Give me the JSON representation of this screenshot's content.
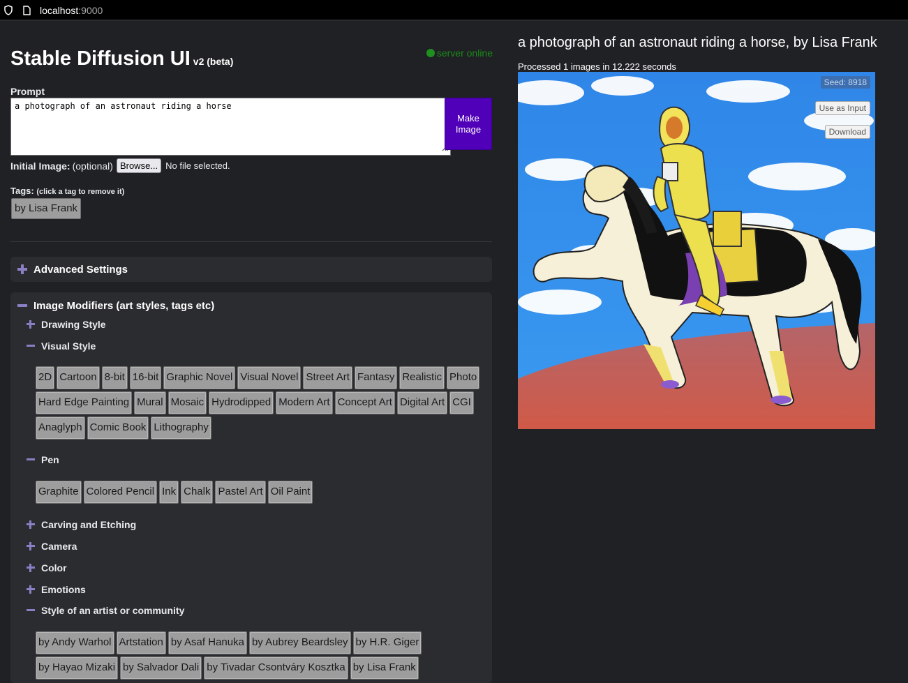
{
  "browser": {
    "url_host": "localhost",
    "url_port": ":9000"
  },
  "app": {
    "title": "Stable Diffusion UI",
    "version": "v2 (beta)",
    "status": "server online"
  },
  "prompt": {
    "label": "Prompt",
    "value": "a photograph of an astronaut riding a horse",
    "make_button": "Make Image"
  },
  "initial_image": {
    "label": "Initial Image:",
    "optional": "(optional)",
    "browse": "Browse...",
    "no_file": "No file selected."
  },
  "tags": {
    "label": "Tags:",
    "hint": "(click a tag to remove it)",
    "items": [
      "by Lisa Frank"
    ]
  },
  "advanced": {
    "label": "Advanced Settings"
  },
  "modifiers": {
    "label": "Image Modifiers (art styles, tags etc)",
    "drawing_style": "Drawing Style",
    "visual_style": {
      "label": "Visual Style",
      "items": [
        "2D",
        "Cartoon",
        "8-bit",
        "16-bit",
        "Graphic Novel",
        "Visual Novel",
        "Street Art",
        "Fantasy",
        "Realistic",
        "Photo",
        "Hard Edge Painting",
        "Mural",
        "Mosaic",
        "Hydrodipped",
        "Modern Art",
        "Concept Art",
        "Digital Art",
        "CGI",
        "Anaglyph",
        "Comic Book",
        "Lithography"
      ]
    },
    "pen": {
      "label": "Pen",
      "items": [
        "Graphite",
        "Colored Pencil",
        "Ink",
        "Chalk",
        "Pastel Art",
        "Oil Paint"
      ]
    },
    "carving": "Carving and Etching",
    "camera": "Camera",
    "color": "Color",
    "emotions": "Emotions",
    "artist": {
      "label": "Style of an artist or community",
      "items": [
        "by Andy Warhol",
        "Artstation",
        "by Asaf Hanuka",
        "by Aubrey Beardsley",
        "by H.R. Giger",
        "by Hayao Mizaki",
        "by Salvador Dali",
        "by Tivadar Csontváry Kosztka",
        "by Lisa Frank"
      ]
    }
  },
  "result": {
    "title": "a photograph of an astronaut riding a horse, by Lisa Frank",
    "info": "Processed 1 images in 12.222 seconds",
    "seed": "Seed: 8918",
    "use_as_input": "Use as Input",
    "download": "Download"
  }
}
